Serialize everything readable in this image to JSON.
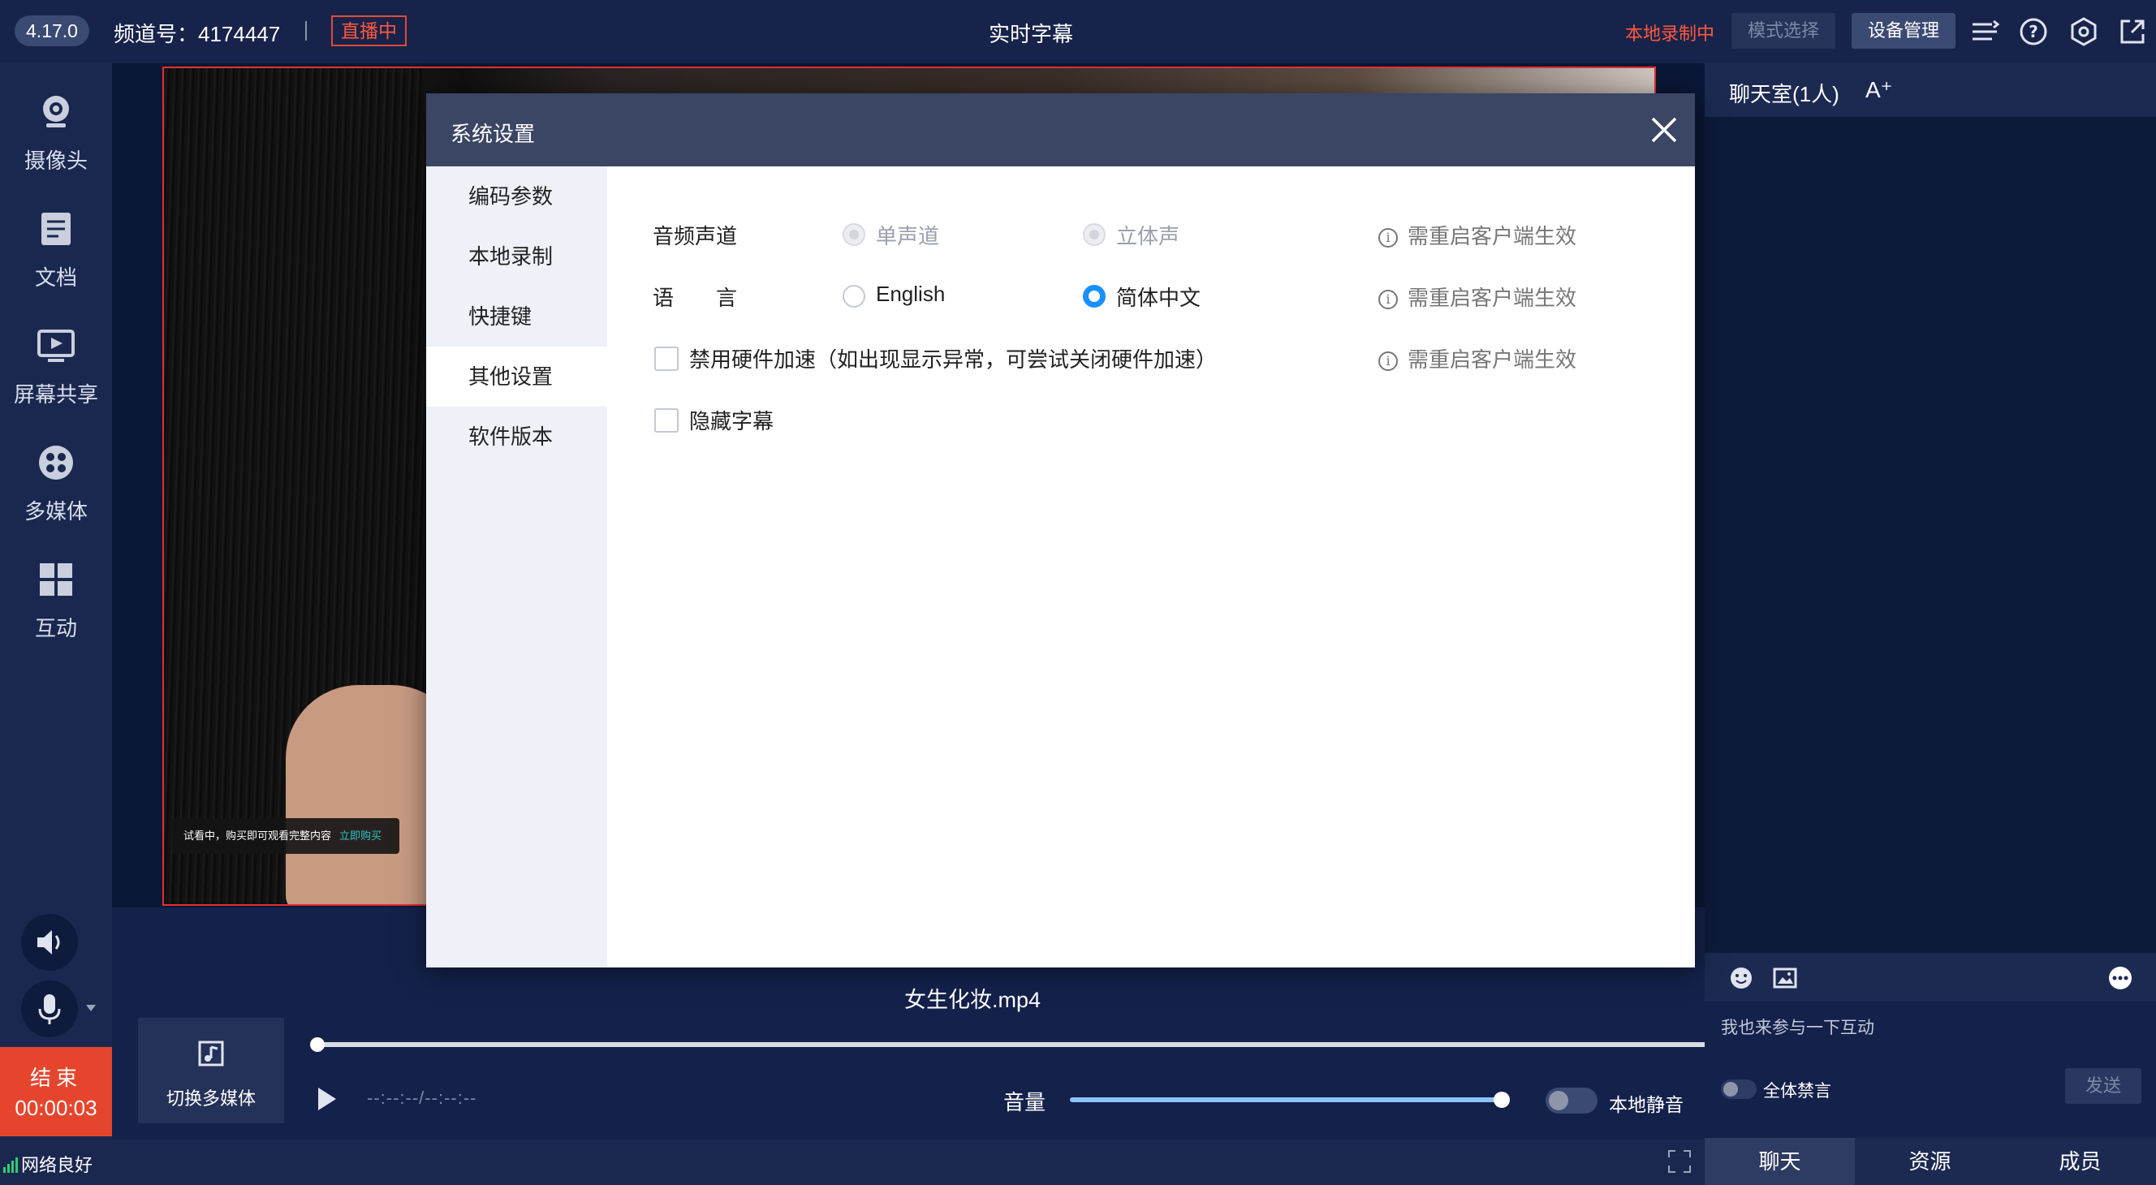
{
  "topbar": {
    "version": "4.17.0",
    "channel": "频道号：4174447",
    "live_badge": "直播中",
    "center_title": "实时字幕",
    "recording": "本地录制中",
    "mode_button": "模式选择",
    "device_button": "设备管理",
    "icons": [
      "list-icon",
      "help-icon",
      "settings-icon",
      "external-icon"
    ]
  },
  "sidebar": {
    "items": [
      {
        "label": "摄像头",
        "icon": "camera-icon"
      },
      {
        "label": "文档",
        "icon": "document-icon"
      },
      {
        "label": "屏幕共享",
        "icon": "screen-share-icon"
      },
      {
        "label": "多媒体",
        "icon": "multimedia-icon"
      },
      {
        "label": "互动",
        "icon": "interaction-icon"
      }
    ],
    "end_label": "结束",
    "end_time": "00:00:03",
    "network": "网络良好"
  },
  "video": {
    "trial_text": "试看中，购买即可观看完整内容",
    "trial_link": "立即购买"
  },
  "media": {
    "title": "女生化妆.mp4",
    "switch_label": "切换多媒体",
    "time": "--:--:--/--:--:--",
    "volume_label": "音量",
    "volume_level": 0.95,
    "mute_label": "本地静音"
  },
  "chat": {
    "title": "聊天室(1人)",
    "font_size_label": "A⁺",
    "input_placeholder": "我也来参与一下互动",
    "ban_all_label": "全体禁言",
    "send_label": "发送",
    "tabs": [
      "聊天",
      "资源",
      "成员"
    ]
  },
  "modal": {
    "title": "系统设置",
    "nav": [
      "编码参数",
      "本地录制",
      "快捷键",
      "其他设置",
      "软件版本"
    ],
    "active_nav": "其他设置",
    "audio_channel": {
      "label": "音频声道",
      "options": [
        "单声道",
        "立体声"
      ],
      "hint": "需重启客户端生效"
    },
    "language": {
      "label": "语　　言",
      "options": [
        "English",
        "简体中文"
      ],
      "selected": "简体中文",
      "hint": "需重启客户端生效"
    },
    "hw_accel": {
      "label": "禁用硬件加速（如出现显示异常，可尝试关闭硬件加速）",
      "hint": "需重启客户端生效"
    },
    "hide_subtitle": {
      "label": "隐藏字幕"
    }
  },
  "colors": {
    "accent": "#1890ff",
    "live_red": "#e5452d",
    "dark_bg": "#0e1a3a"
  }
}
